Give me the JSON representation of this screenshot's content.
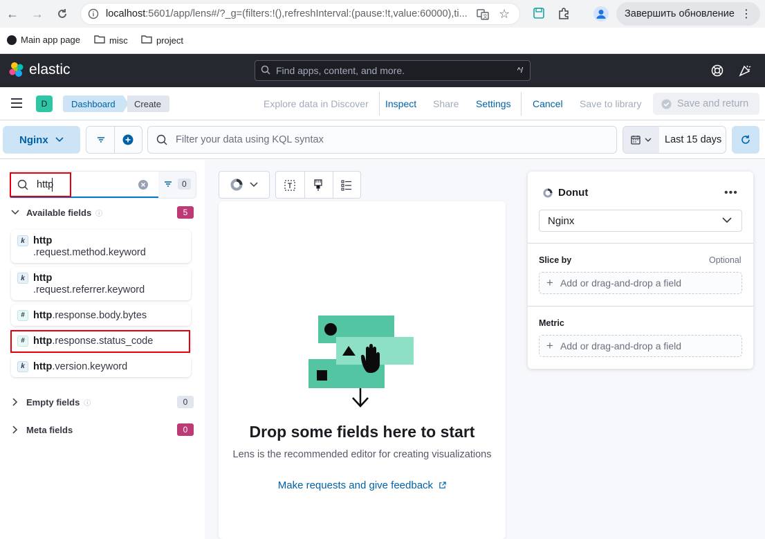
{
  "browser": {
    "url_host": "localhost",
    "url_rest": ":5601/app/lens#/?_g=(filters:!(),refreshInterval:(pause:!t,value:60000),ti...",
    "finish_update_label": "Завершить обновление",
    "bookmarks": [
      {
        "label": "Main app page",
        "icon": "elastic-bookmark-icon"
      },
      {
        "label": "misc",
        "icon": "folder-icon"
      },
      {
        "label": "project",
        "icon": "folder-icon"
      }
    ]
  },
  "header": {
    "logo_text": "elastic",
    "search_placeholder": "Find apps, content, and more.",
    "search_shortcut": "^/"
  },
  "breadcrumbs": {
    "space_initial": "D",
    "items": [
      "Dashboard",
      "Create"
    ]
  },
  "top_nav": {
    "explore": "Explore data in Discover",
    "inspect": "Inspect",
    "share": "Share",
    "settings": "Settings",
    "cancel": "Cancel",
    "save_library": "Save to library",
    "save_return": "Save and return"
  },
  "query_bar": {
    "data_view": "Nginx",
    "placeholder": "Filter your data using KQL syntax",
    "date_range": "Last 15 days"
  },
  "field_list": {
    "search_value": "http",
    "filter_count": "0",
    "available": {
      "label": "Available fields",
      "count": "5"
    },
    "fields": [
      {
        "type": "k",
        "match": "http",
        "rest": ".request.method.keyword",
        "wrap": true
      },
      {
        "type": "k",
        "match": "http",
        "rest": ".request.referrer.keyword",
        "wrap": true
      },
      {
        "type": "#",
        "match": "http",
        "rest": ".response.body.bytes",
        "wrap": false
      },
      {
        "type": "#",
        "match": "http",
        "rest": ".response.status_code",
        "wrap": false
      },
      {
        "type": "k",
        "match": "http",
        "rest": ".version.keyword",
        "wrap": false
      }
    ],
    "empty": {
      "label": "Empty fields",
      "count": "0"
    },
    "meta": {
      "label": "Meta fields",
      "count": "0"
    }
  },
  "workspace": {
    "drop_title": "Drop some fields here to start",
    "drop_subtitle": "Lens is the recommended editor for creating visualizations",
    "feedback_link": "Make requests and give feedback"
  },
  "config": {
    "chart_type": "Donut",
    "layer_data_view": "Nginx",
    "slice_by_label": "Slice by",
    "slice_by_optional": "Optional",
    "metric_label": "Metric",
    "dropzone_text": "Add or drag-and-drop a field"
  },
  "colors": {
    "header_bg": "#25282f",
    "link": "#0061a6",
    "accent_pink": "#bd271e",
    "highlight_red": "#e7000b",
    "illustration_green": "#54c5a2"
  }
}
